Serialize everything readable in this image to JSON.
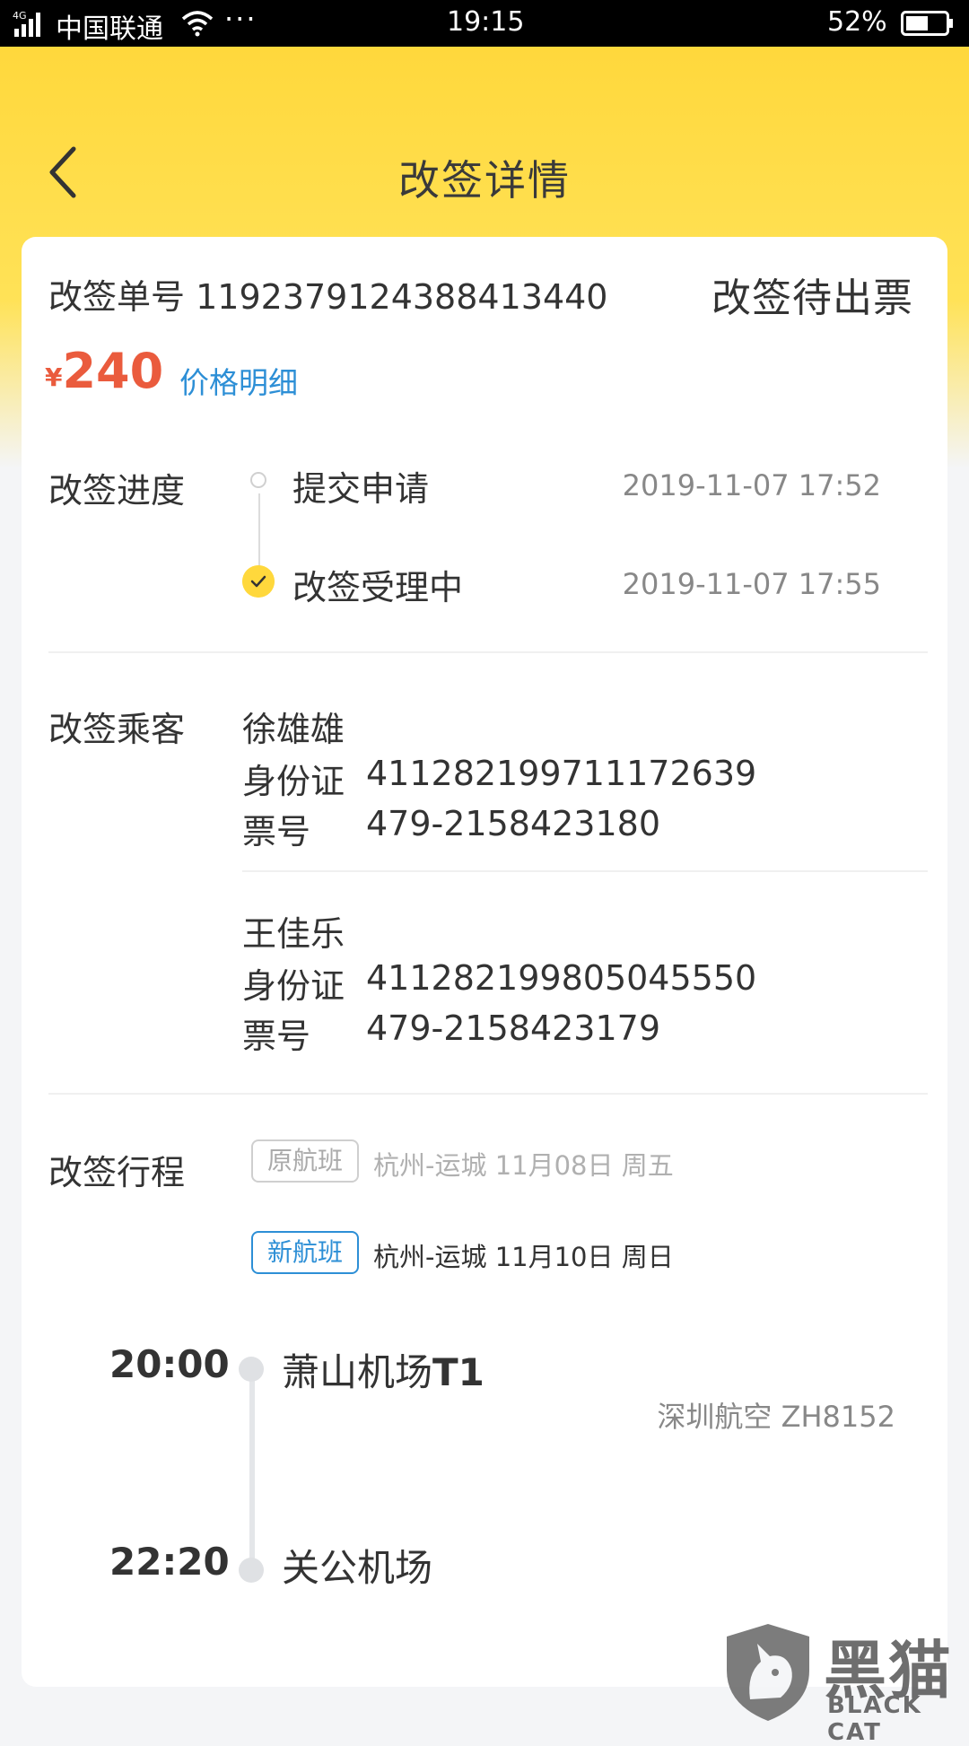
{
  "status_bar": {
    "network": "4G",
    "carrier": "中国联通",
    "dots": "···",
    "time": "19:15",
    "battery": "52%"
  },
  "header": {
    "title": "改签详情"
  },
  "order": {
    "number_label": "改签单号",
    "number": "1192379124388413440",
    "status": "改签待出票",
    "currency": "¥",
    "price": "240",
    "price_detail": "价格明细"
  },
  "progress": {
    "label": "改签进度",
    "steps": [
      {
        "name": "提交申请",
        "time": "2019-11-07 17:52",
        "done": false
      },
      {
        "name": "改签受理中",
        "time": "2019-11-07 17:55",
        "done": true
      }
    ]
  },
  "passengers": {
    "label": "改签乘客",
    "id_label": "身份证",
    "ticket_label": "票号",
    "list": [
      {
        "name": "徐雄雄",
        "id": "411282199711172639",
        "ticket": "479-2158423180"
      },
      {
        "name": "王佳乐",
        "id": "411282199805045550",
        "ticket": "479-2158423179"
      }
    ]
  },
  "itinerary": {
    "label": "改签行程",
    "original": {
      "tag": "原航班",
      "route": "杭州-运城",
      "date": "11月08日",
      "weekday": "周五"
    },
    "new": {
      "tag": "新航班",
      "route": "杭州-运城",
      "date": "11月10日",
      "weekday": "周日"
    },
    "departure": {
      "time": "20:00",
      "airport": "萧山机场",
      "terminal": "T1"
    },
    "arrival": {
      "time": "22:20",
      "airport": "关公机场"
    },
    "airline": "深圳航空 ZH8152"
  },
  "watermark": {
    "cn": "黑猫",
    "en": "BLACK CAT"
  },
  "colors": {
    "accent_yellow": "#ffd83c",
    "price_red": "#ea5b3d",
    "link_blue": "#2d8fd6"
  }
}
